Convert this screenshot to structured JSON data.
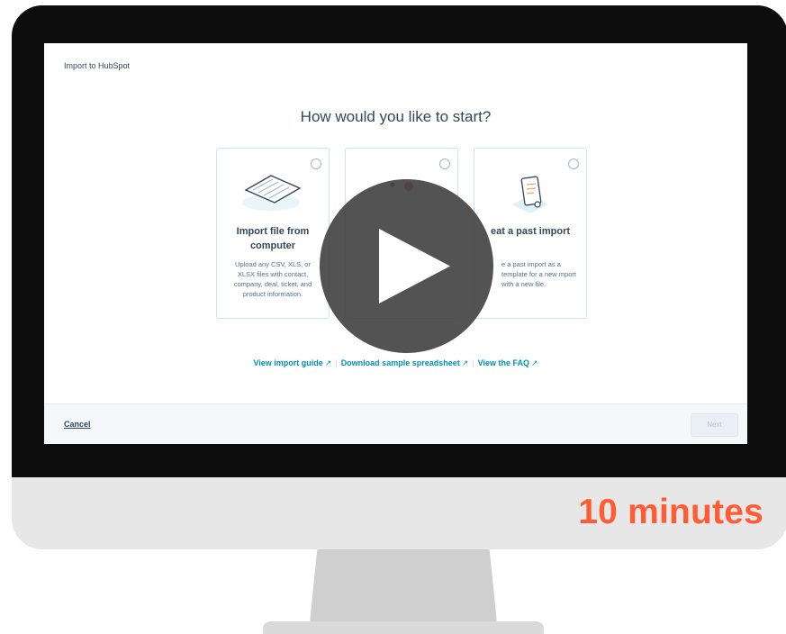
{
  "window": {
    "breadcrumb": "Import to HubSpot"
  },
  "main": {
    "heading": "How would you like to start?",
    "cards": [
      {
        "title": "Import file from computer",
        "desc": "Upload any CSV, XLS, or XLSX files with contact, company, deal, ticket, and product information.",
        "icon": "paper-file-icon"
      },
      {
        "title": "",
        "desc": "",
        "icon": "integration-icon"
      },
      {
        "title": "eat a past import",
        "desc": "e a past import as a template for a new mport with a new file.",
        "icon": "clipboard-icon"
      }
    ],
    "links": [
      {
        "label": "View import guide",
        "icon": "external-link-icon"
      },
      {
        "label": "Download sample spreadsheet",
        "icon": "external-link-icon"
      },
      {
        "label": "View the FAQ",
        "icon": "external-link-icon"
      }
    ]
  },
  "footer": {
    "cancel_label": "Cancel",
    "next_label": "Next"
  },
  "overlay": {
    "icon": "play-icon",
    "duration_label": "10 minutes",
    "accent": "#ff5c35"
  },
  "colors": {
    "text": "#33475b",
    "link": "#0091ae",
    "card_border": "#cbe8f0"
  }
}
